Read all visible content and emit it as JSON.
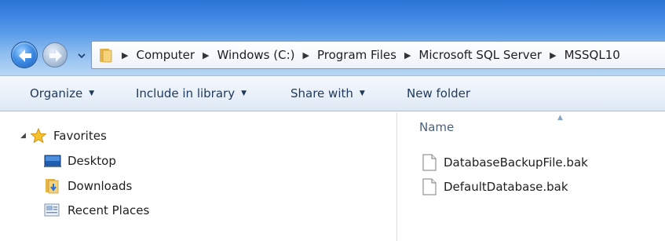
{
  "window": {
    "breadcrumb": [
      "Computer",
      "Windows (C:)",
      "Program Files",
      "Microsoft SQL Server",
      "MSSQL10"
    ]
  },
  "toolbar": {
    "organize": "Organize",
    "include_in_library": "Include in library",
    "share_with": "Share with",
    "new_folder": "New folder"
  },
  "nav": {
    "favorites": "Favorites",
    "items": [
      "Desktop",
      "Downloads",
      "Recent Places"
    ]
  },
  "content": {
    "column_name": "Name",
    "files": [
      "DatabaseBackupFile.bak",
      "DefaultDatabase.bak"
    ]
  },
  "colors": {
    "title_gradient_top": "#2a74d6",
    "toolbar_text": "#1e395b",
    "header_text": "#4c607a"
  }
}
